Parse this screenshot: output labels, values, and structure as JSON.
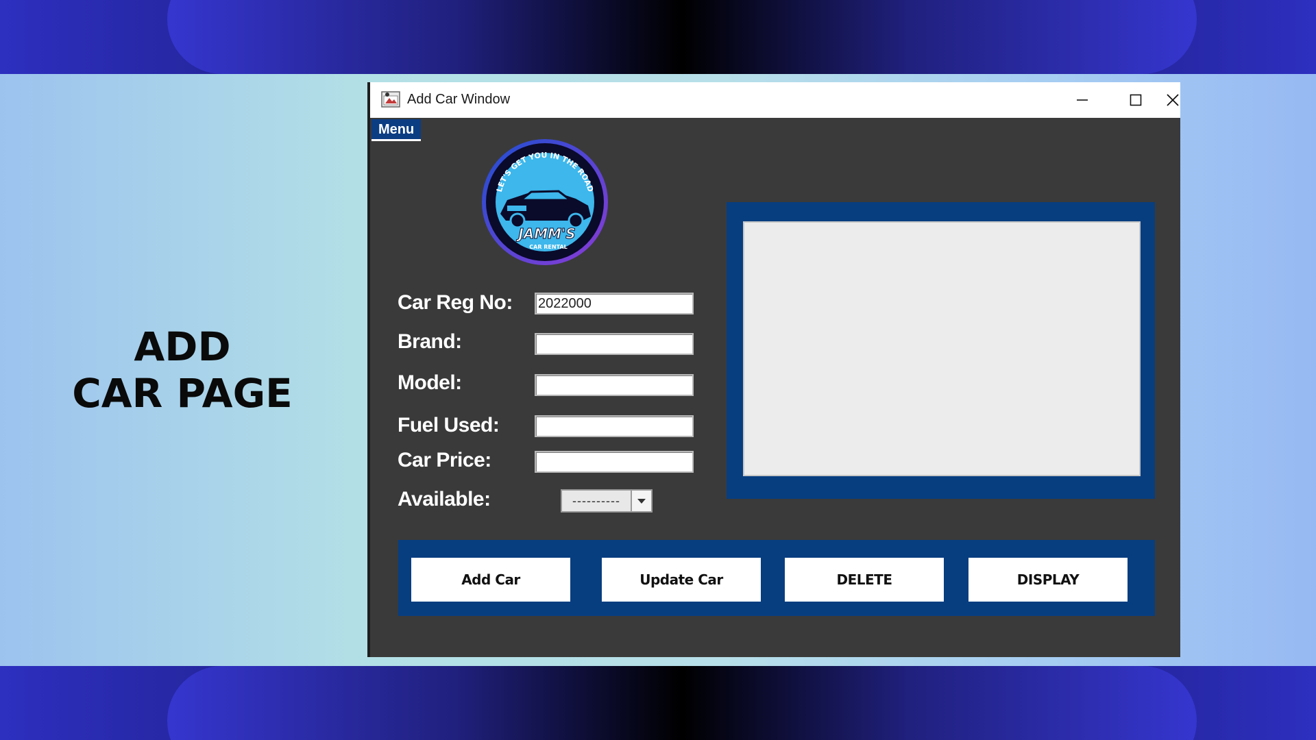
{
  "slide": {
    "heading_line1": "ADD",
    "heading_line2": "CAR PAGE"
  },
  "window": {
    "title": "Add Car Window",
    "menu_label": "Menu",
    "logo": {
      "ring_text": "LET'S GET YOU IN THE ROAD",
      "brand": "JAMM'S",
      "tagline": "CAR RENTAL"
    }
  },
  "form": {
    "fields": [
      {
        "label": "Car Reg No:",
        "value": ""
      },
      {
        "label": "Brand:",
        "value": ""
      },
      {
        "label": "Model:",
        "value": ""
      },
      {
        "label": "Fuel Used:",
        "value": ""
      },
      {
        "label": "Car Price:",
        "value": ""
      }
    ],
    "car_reg_value": "2022000",
    "available_label": "Available:",
    "available_selected": "----------"
  },
  "buttons": {
    "add": "Add Car",
    "update": "Update Car",
    "delete": "DELETE",
    "display": "DISPLAY"
  },
  "colors": {
    "panel_blue": "#073e80",
    "window_bg": "#3a3a3a",
    "logo_sky": "#3db7ec"
  },
  "icons": [
    "app-icon",
    "minimize-icon",
    "maximize-icon",
    "close-icon",
    "dropdown-arrow-icon"
  ]
}
